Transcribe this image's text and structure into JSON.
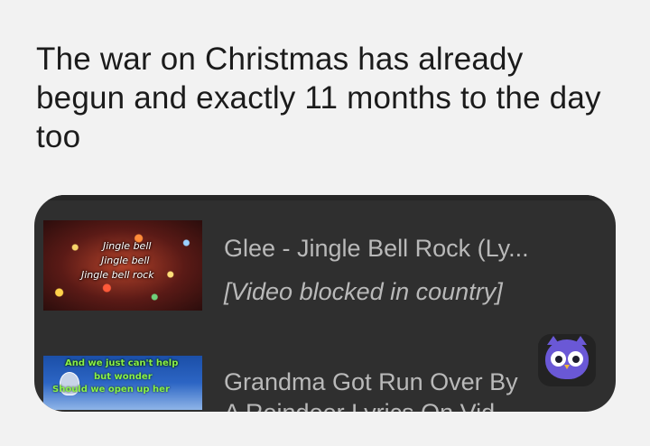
{
  "post": {
    "text": "The war on Christmas has already begun and exactly 11 months to the day too"
  },
  "playlist": {
    "items": [
      {
        "title": "Glee - Jingle Bell Rock (Ly...",
        "status": "[Video blocked in country]",
        "thumbnail_lines": [
          "Jingle bell",
          "Jingle bell",
          "Jingle bell rock"
        ]
      },
      {
        "title": "Grandma Got Run Over By",
        "subtitle": "A Reindeer Lyrics On Vid",
        "thumbnail_lines": [
          "And we just can't help",
          "but wonder",
          "Should we open up her"
        ]
      }
    ]
  },
  "floating_button": {
    "icon": "owl-icon"
  },
  "colors": {
    "page_background": "#f2f2f2",
    "card_background": "#2f2f2f",
    "card_text": "#b9b9b9",
    "owl_accent": "#6a58d6"
  }
}
